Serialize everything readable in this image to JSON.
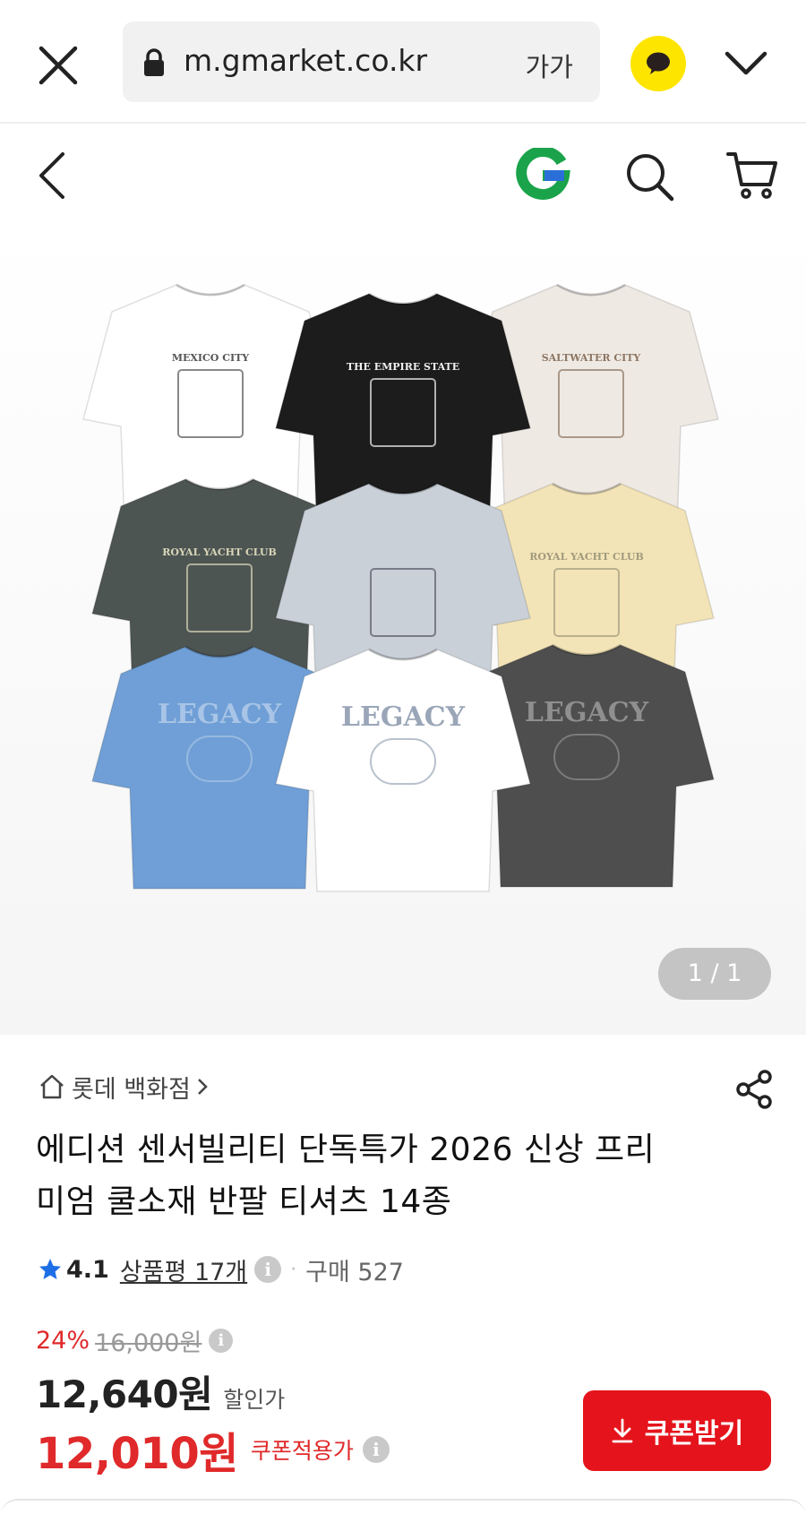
{
  "browser": {
    "url": "m.gmarket.co.kr",
    "text_size_label": "가가"
  },
  "gallery": {
    "page_indicator": "1 / 1",
    "shirts": [
      {
        "color": "#ffffff",
        "graphic": "MEXICO CITY",
        "ink": "#555"
      },
      {
        "color": "#1c1c1c",
        "graphic": "THE EMPIRE STATE",
        "ink": "#f0f0f0"
      },
      {
        "color": "#efe9e3",
        "graphic": "SALTWATER CITY",
        "ink": "#8b7562"
      },
      {
        "color": "#4d5553",
        "graphic": "ROYAL YACHT CLUB",
        "ink": "#d9d6b8"
      },
      {
        "color": "#c9d0d8",
        "graphic": "",
        "ink": "#556"
      },
      {
        "color": "#f3e4b7",
        "graphic": "ROYAL YACHT CLUB",
        "ink": "#a09a7c"
      },
      {
        "color": "#6f9fd6",
        "graphic": "LEGACY",
        "ink": "#a8c4e6"
      },
      {
        "color": "#ffffff",
        "graphic": "LEGACY",
        "ink": "#9aa6b8"
      },
      {
        "color": "#4e4e4e",
        "graphic": "LEGACY",
        "ink": "#8f8f8f"
      }
    ]
  },
  "product": {
    "brand": "롯데 백화점",
    "title": "에디션 센서빌리티 단독특가 2026 신상 프리미엄 쿨소재 반팔 티셔츠 14종",
    "rating": "4.1",
    "review_link": "상품평 17개",
    "purchase": "구매 527",
    "discount_rate": "24%",
    "original_price": "16,000원",
    "sale_price": "12,640원",
    "sale_label": "할인가",
    "coupon_price": "12,010원",
    "coupon_label": "쿠폰적용가",
    "coupon_button": "쿠폰받기"
  },
  "colors": {
    "accent_red": "#e5141c",
    "kakao_yellow": "#fee500",
    "rating_star": "#1e6fe6"
  }
}
